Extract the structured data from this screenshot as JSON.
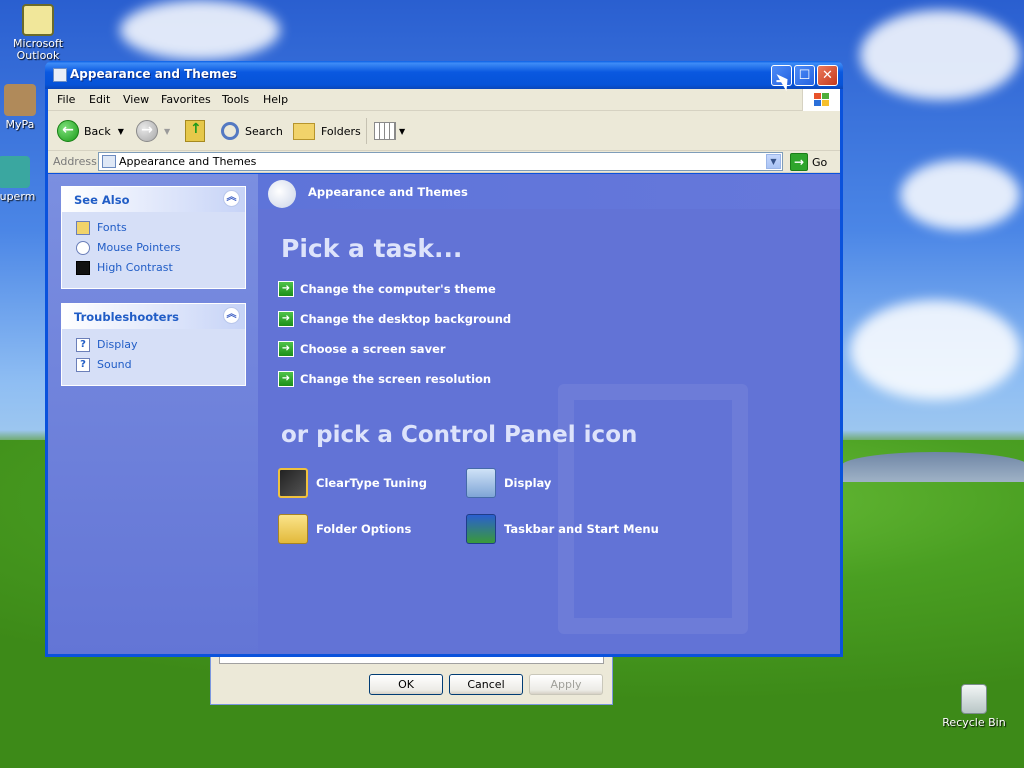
{
  "desktop": {
    "icons": [
      {
        "label": "Microsoft Outlook"
      },
      {
        "label": "MyPa"
      },
      {
        "label": "Superm"
      },
      {
        "label": "Recycle Bin"
      }
    ]
  },
  "dialog": {
    "ok": "OK",
    "cancel": "Cancel",
    "apply": "Apply"
  },
  "window": {
    "title": "Appearance and Themes",
    "menu": [
      "File",
      "Edit",
      "View",
      "Favorites",
      "Tools",
      "Help"
    ],
    "toolbar": {
      "back": "Back",
      "search": "Search",
      "folders": "Folders"
    },
    "address": {
      "label": "Address",
      "value": "Appearance and Themes",
      "go": "Go"
    },
    "see_also": {
      "title": "See Also",
      "items": [
        "Fonts",
        "Mouse Pointers",
        "High Contrast"
      ]
    },
    "troubleshooters": {
      "title": "Troubleshooters",
      "items": [
        "Display",
        "Sound"
      ]
    },
    "header_title": "Appearance and Themes",
    "pick_task": "Pick a task...",
    "tasks": [
      "Change the computer's theme",
      "Change the desktop background",
      "Choose a screen saver",
      "Change the screen resolution"
    ],
    "pick_icon": "or pick a Control Panel icon",
    "icons": [
      "ClearType Tuning",
      "Display",
      "Folder Options",
      "Taskbar and Start Menu"
    ]
  },
  "colors": {
    "titlebar": "#0a58e0",
    "pane": "#6273d6",
    "link": "#215dc6"
  }
}
